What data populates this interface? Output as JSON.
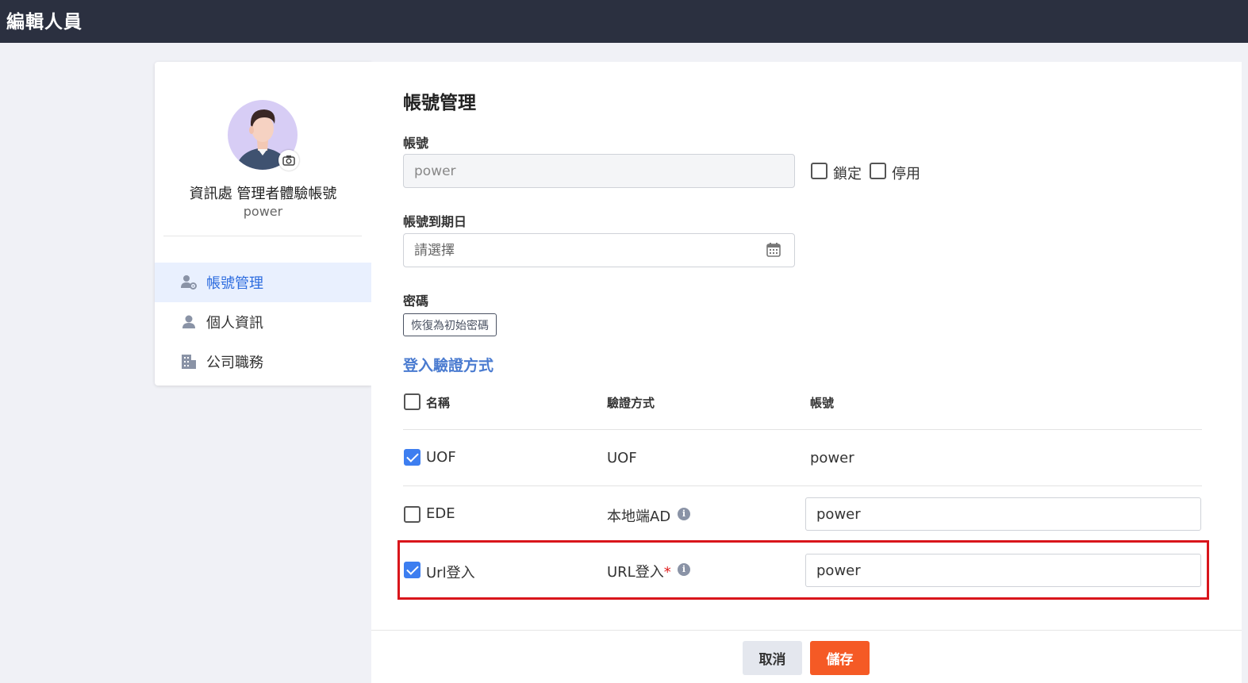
{
  "header": {
    "title": "編輯人員"
  },
  "profile": {
    "name": "資訊處 管理者體驗帳號",
    "account": "power"
  },
  "nav": {
    "items": [
      {
        "label": "帳號管理",
        "icon": "user-gear-icon",
        "active": true
      },
      {
        "label": "個人資訊",
        "icon": "user-icon",
        "active": false
      },
      {
        "label": "公司職務",
        "icon": "building-icon",
        "active": false
      }
    ]
  },
  "form": {
    "section_title": "帳號管理",
    "account": {
      "label": "帳號",
      "value": "power"
    },
    "lock_label": "鎖定",
    "disable_label": "停用",
    "expiry": {
      "label": "帳號到期日",
      "placeholder": "請選擇"
    },
    "password": {
      "label": "密碼",
      "reset_button": "恢復為初始密碼"
    },
    "login_section_title": "登入驗證方式"
  },
  "auth_table": {
    "headers": {
      "name": "名稱",
      "method": "驗證方式",
      "account": "帳號"
    },
    "rows": [
      {
        "checked": true,
        "name": "UOF",
        "method": "UOF",
        "account": "power",
        "editable": false
      },
      {
        "checked": false,
        "name": "EDE",
        "method": "本地端AD",
        "account": "power",
        "editable": true,
        "info": true
      },
      {
        "checked": true,
        "name": "Url登入",
        "method": "URL登入",
        "required_mark": "*",
        "account": "power",
        "editable": true,
        "info": true
      }
    ]
  },
  "footer": {
    "cancel_label": "取消",
    "save_label": "儲存"
  },
  "colors": {
    "topbar": "#2b3040",
    "accent": "#2d6cdf",
    "save": "#f55a25",
    "highlight": "#d9151b"
  }
}
